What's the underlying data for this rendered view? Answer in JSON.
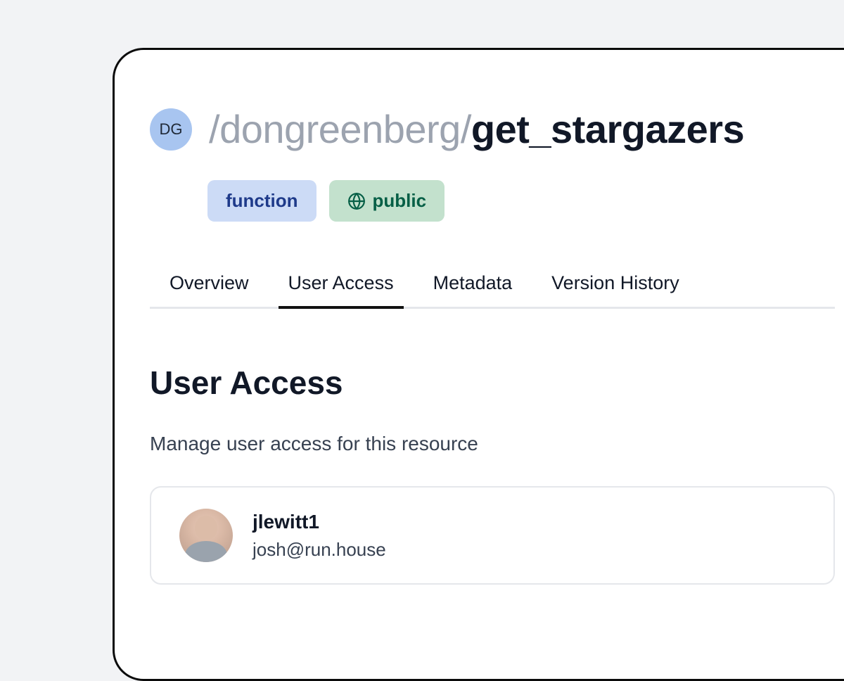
{
  "owner": {
    "initials": "DG",
    "username": "dongreenberg"
  },
  "resource": {
    "name": "get_stargazers",
    "type_label": "function",
    "visibility_label": "public"
  },
  "tabs": [
    {
      "label": "Overview"
    },
    {
      "label": "User Access"
    },
    {
      "label": "Metadata"
    },
    {
      "label": "Version History"
    }
  ],
  "active_tab_index": 1,
  "section": {
    "title": "User Access",
    "description": "Manage user access for this resource"
  },
  "users": [
    {
      "username": "jlewitt1",
      "email": "josh@run.house"
    }
  ]
}
